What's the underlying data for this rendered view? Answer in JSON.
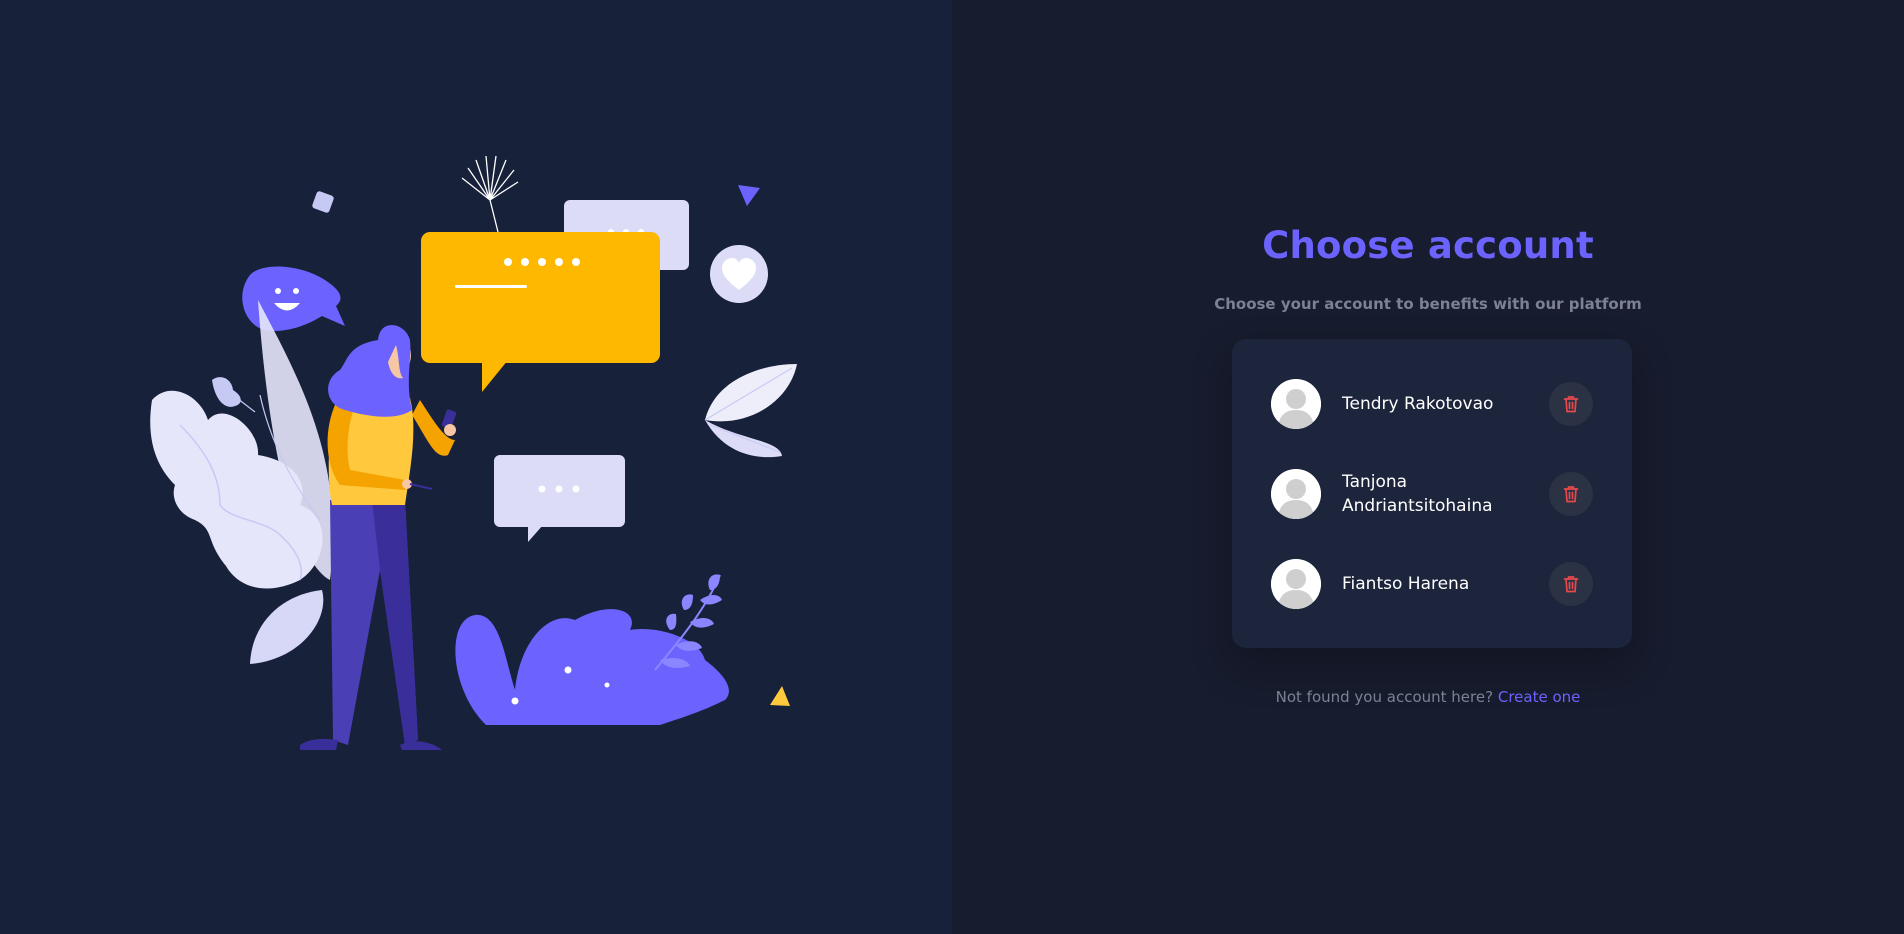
{
  "colors": {
    "left_background": "#18213a",
    "right_background": "#171c2e",
    "card_background": "#1c253c",
    "accent": "#6c63ff",
    "muted_text": "#7c8294",
    "delete_icon": "#e5484d",
    "delete_button_bg": "#2b3243"
  },
  "illustration": {
    "icon": "woman-chatting-illustration"
  },
  "header": {
    "title": "Choose account",
    "subtitle": "Choose your account to benefits with our platform"
  },
  "accounts": [
    {
      "name": "Tendry Rakotovao",
      "avatar_icon": "user-avatar-icon",
      "delete_icon": "trash-icon"
    },
    {
      "name": "Tanjona Andriantsitohaina",
      "avatar_icon": "user-avatar-icon",
      "delete_icon": "trash-icon"
    },
    {
      "name": "Fiantso Harena",
      "avatar_icon": "user-avatar-icon",
      "delete_icon": "trash-icon"
    }
  ],
  "footer": {
    "prompt": "Not found you account here?",
    "link_label": "Create one"
  }
}
